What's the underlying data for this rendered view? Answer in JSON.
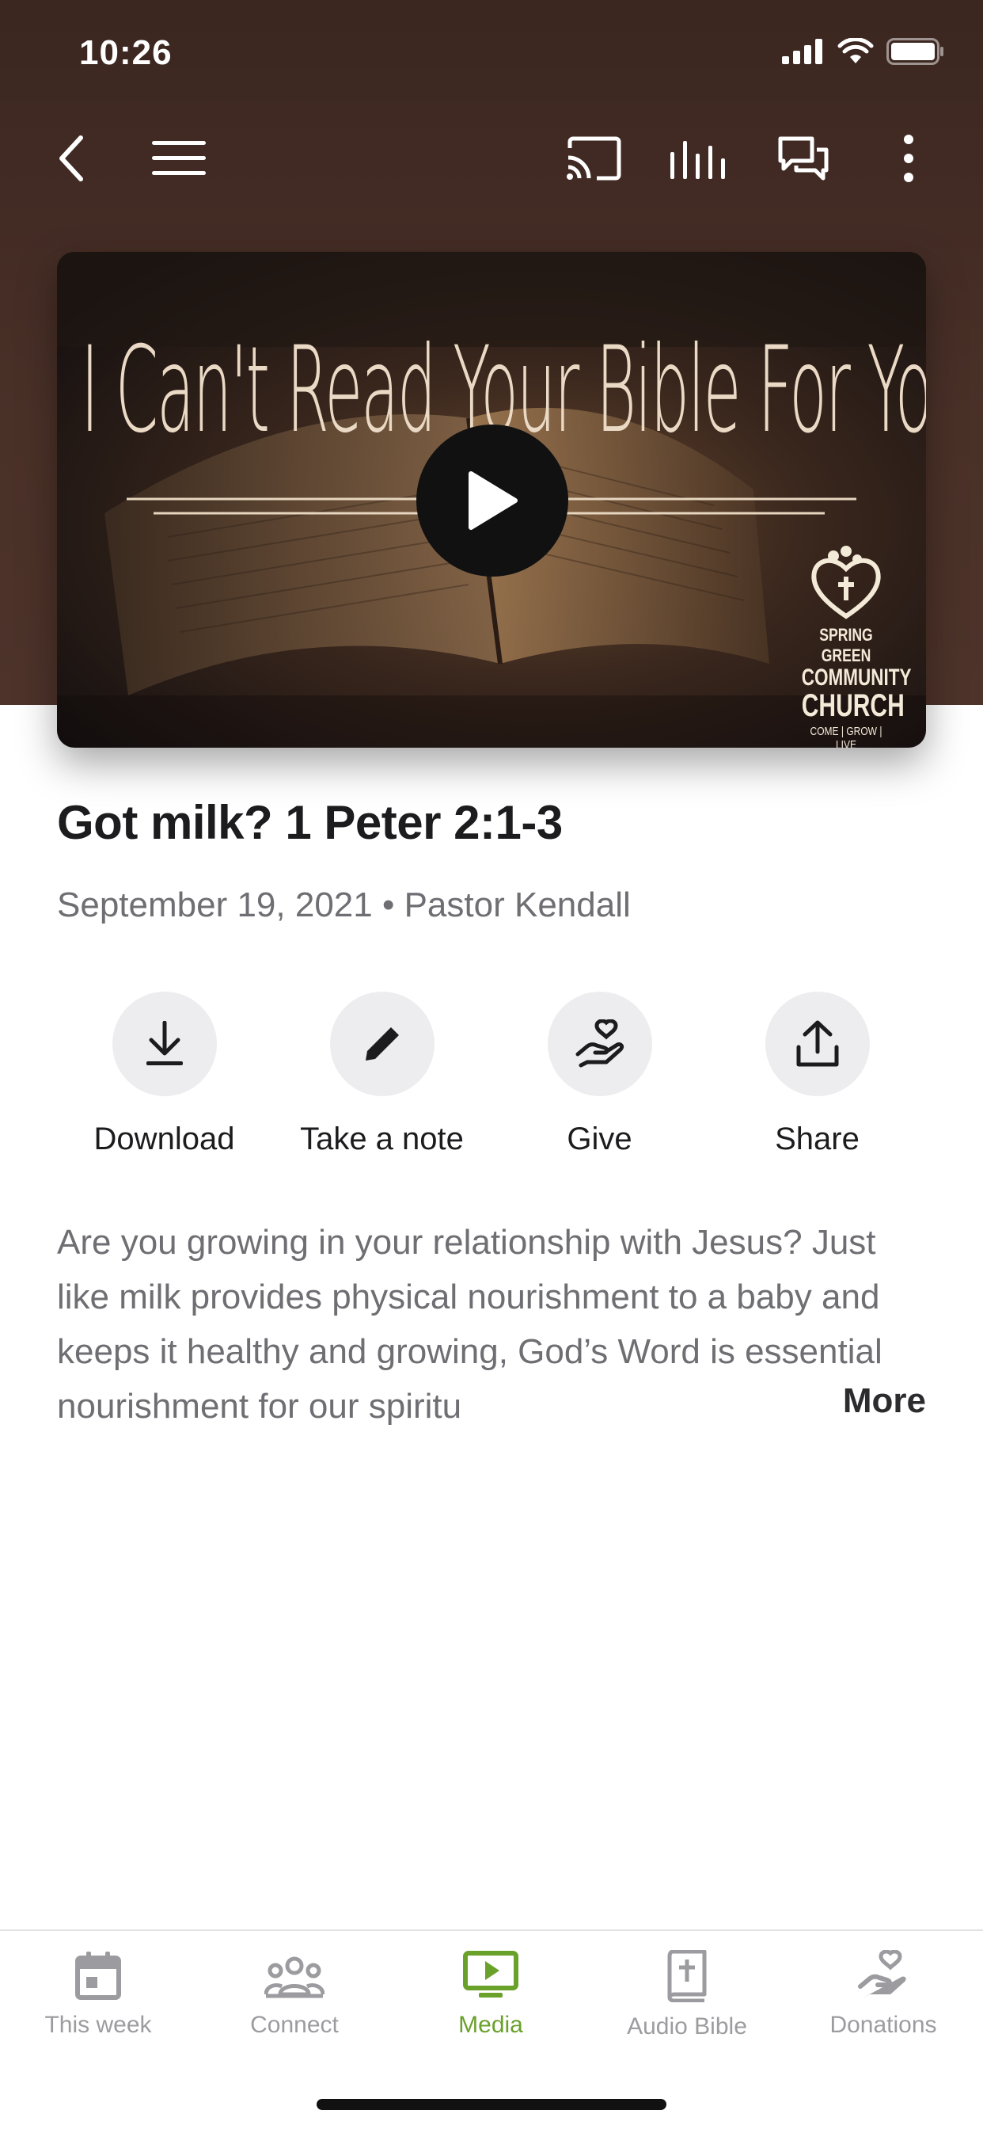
{
  "status_bar": {
    "time": "10:26"
  },
  "toolbar": {
    "icons": [
      "back-icon",
      "menu-icon",
      "cast-icon",
      "audio-levels-icon",
      "chat-icon",
      "more-vertical-icon"
    ]
  },
  "video": {
    "thumbnail_title": "I Can't Read Your Bible For You",
    "church_logo": {
      "line1": "SPRING GREEN",
      "line2": "COMMUNITY",
      "line3": "CHURCH",
      "tagline": "COME | GROW | LIVE"
    }
  },
  "sermon": {
    "title": "Got milk? 1 Peter 2:1-3",
    "meta": "September 19, 2021 • Pastor Kendall",
    "description": "Are you growing in your relationship with Jesus? Just like milk provides physical nourishment to a baby and keeps it healthy and growing, God’s Word is essential nourishment for our spiritu",
    "more_label": "More"
  },
  "actions": [
    {
      "label": "Download",
      "icon": "download-icon"
    },
    {
      "label": "Take a note",
      "icon": "pencil-icon"
    },
    {
      "label": "Give",
      "icon": "give-hand-heart-icon"
    },
    {
      "label": "Share",
      "icon": "share-icon"
    }
  ],
  "tabs": [
    {
      "label": "This week",
      "icon": "calendar-icon",
      "active": false
    },
    {
      "label": "Connect",
      "icon": "people-icon",
      "active": false
    },
    {
      "label": "Media",
      "icon": "tv-play-icon",
      "active": true
    },
    {
      "label": "Audio Bible",
      "icon": "bible-icon",
      "active": false
    },
    {
      "label": "Donations",
      "icon": "hand-heart-icon",
      "active": false
    }
  ],
  "colors": {
    "hero_background": "#4a3128",
    "accent_active_tab": "#6aa12a",
    "inactive_tab": "#9c9ca0"
  }
}
